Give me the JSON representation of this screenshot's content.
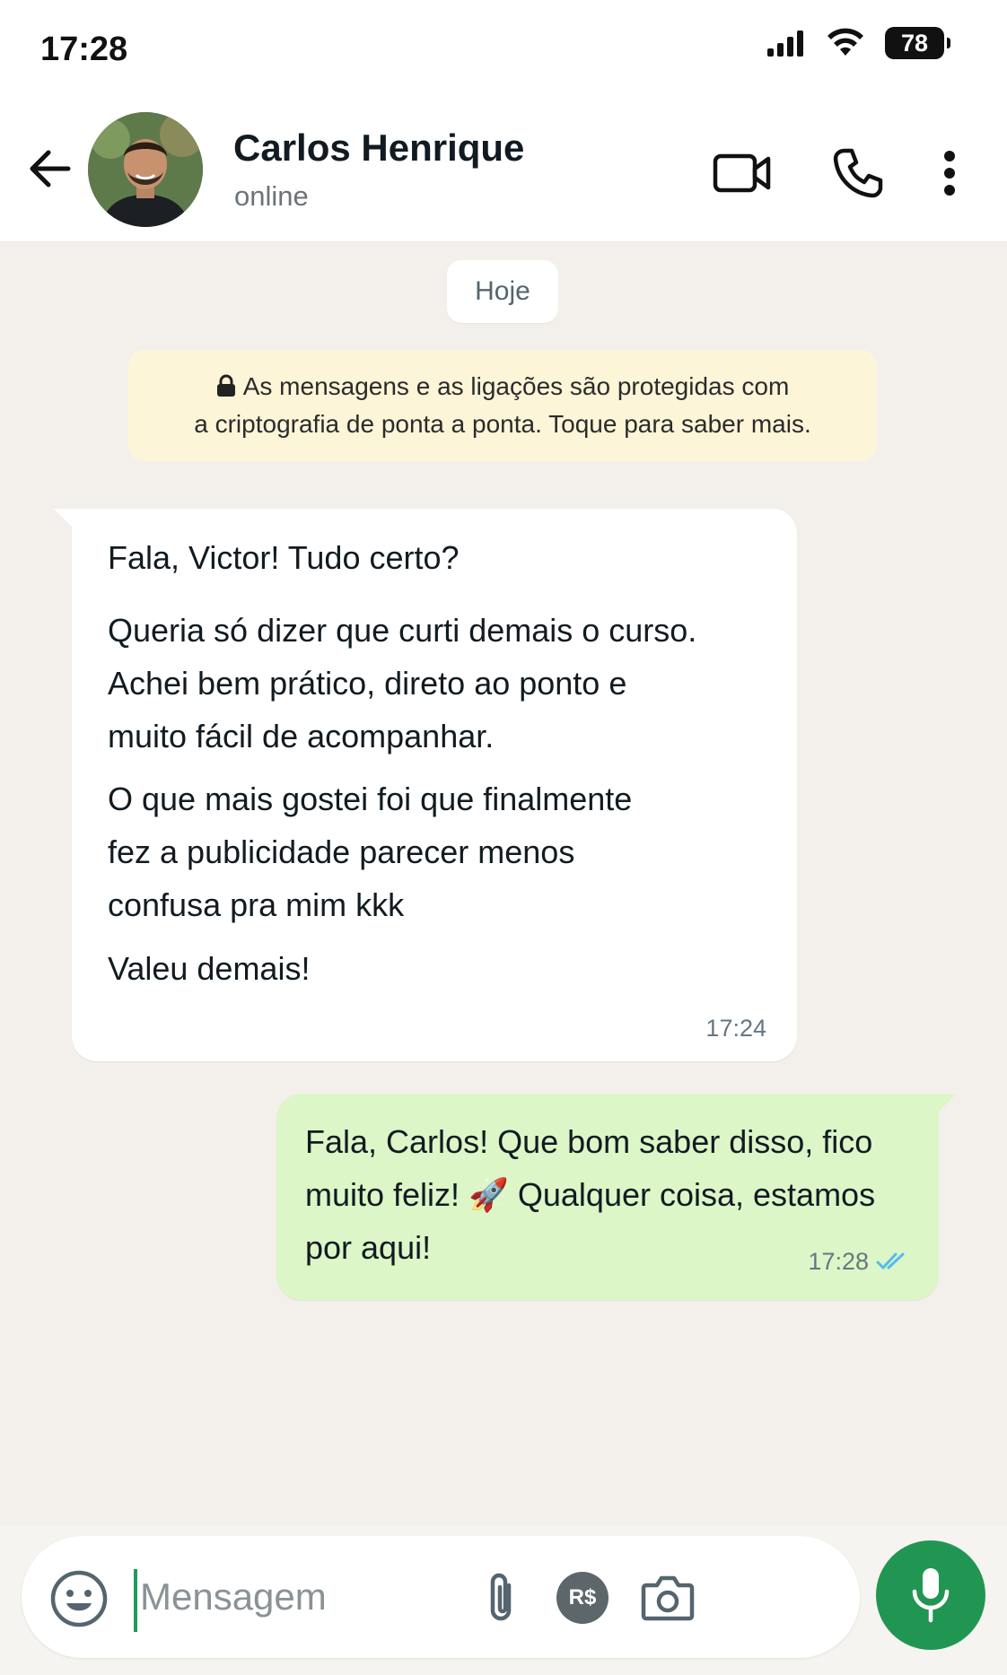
{
  "status_bar": {
    "time": "17:28",
    "battery_level": "78",
    "icons": [
      "signal-icon",
      "wifi-icon",
      "battery-icon"
    ]
  },
  "header": {
    "contact_name": "Carlos Henrique",
    "contact_status": "online",
    "icons": [
      "back-arrow-icon",
      "video-call-icon",
      "voice-call-icon",
      "more-options-icon"
    ]
  },
  "chat": {
    "date_label": "Hoje",
    "encryption_notice": {
      "line1": "As mensagens e as ligações são protegidas com",
      "line2": "a criptografia de ponta a ponta. Toque para saber mais."
    },
    "messages": [
      {
        "direction": "incoming",
        "lines": [
          "Fala, Victor! Tudo certo?",
          "Queria só dizer que curti demais o curso.",
          "Achei bem prático, direto ao ponto e",
          "muito fácil de acompanhar.",
          "O que mais gostei foi que finalmente",
          "fez a publicidade parecer menos",
          "confusa pra mim kkk",
          "Valeu demais!"
        ],
        "time": "17:24"
      },
      {
        "direction": "outgoing",
        "lines": [
          "Fala, Carlos! Que bom saber disso, fico",
          "muito feliz! 🚀 Qualquer coisa, estamos",
          "por aqui!"
        ],
        "time": "17:28",
        "status": "read"
      }
    ]
  },
  "composer": {
    "placeholder": "Mensagem",
    "value": "",
    "payment_badge": "R$",
    "icons": [
      "emoji-icon",
      "attach-icon",
      "payment-icon",
      "camera-icon",
      "mic-icon"
    ]
  },
  "colors": {
    "accent": "#219653",
    "outgoing_bubble": "#dcf6c7",
    "incoming_bubble": "#ffffff",
    "chat_background": "#f3f0eb",
    "encryption_notice_bg": "#fdf5d8",
    "read_ticks": "#53bdeb"
  }
}
